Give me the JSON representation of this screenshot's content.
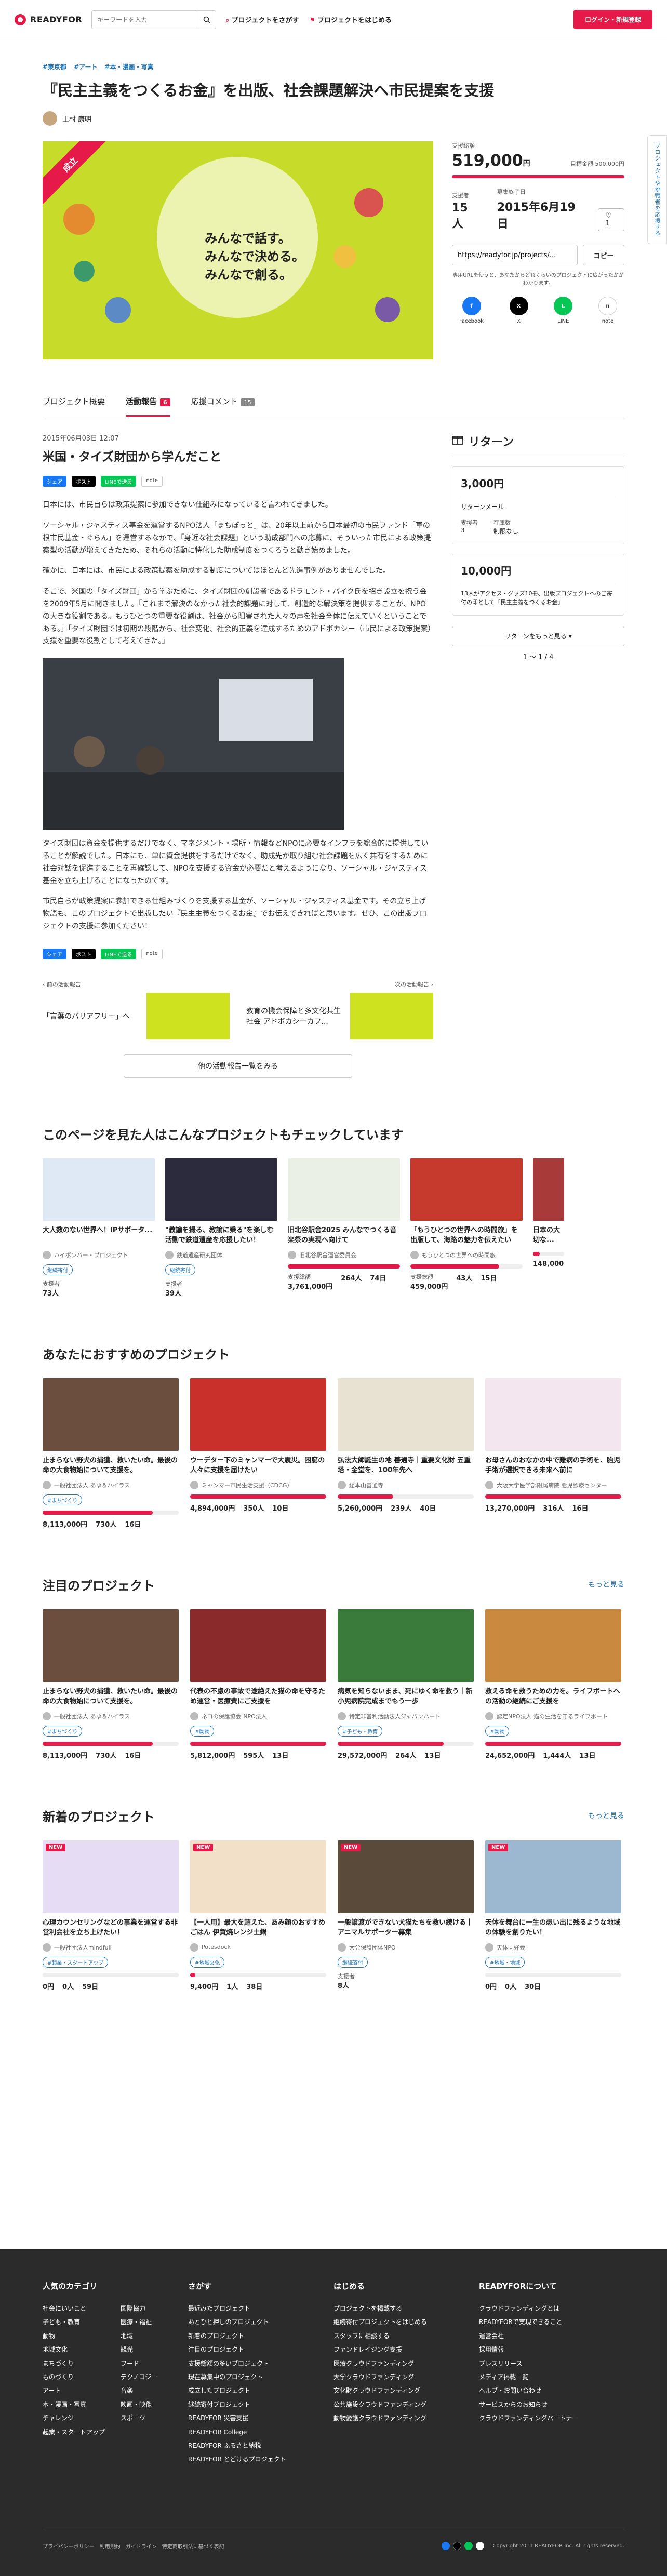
{
  "header": {
    "brand": "READYFOR",
    "search_placeholder": "キーワードを入力",
    "nav": [
      "プロジェクトをさがす",
      "プロジェクトをはじめる"
    ],
    "login": "ログイン・新規登録"
  },
  "side_tab": "プロジェクトや挑戦者を応援する",
  "project": {
    "tags": [
      "#東京都",
      "#アート",
      "#本・漫画・写真"
    ],
    "title": "『民主主義をつくるお金』を出版、社会課題解決へ市民提案を支援",
    "owner": "上村 康明",
    "hero_ribbon": "成立",
    "hero_lines": [
      "みんなで話す。",
      "みんなで決める。",
      "みんなで創る。"
    ],
    "raised_label": "支援総額",
    "raised": "519,000",
    "raised_unit": "円",
    "goal": "目標金額 500,000円",
    "backers_label": "支援者",
    "backers": "15人",
    "end_label": "募集終了日",
    "end_date": "2015年6月19日",
    "bookmark_count": "1",
    "share_url": "https://readyfor.jp/projects/...",
    "copy": "コピー",
    "notice": "専用URLを使うと、あなたからどれくらいのプロジェクトに広がったかがわかります。",
    "sns": [
      "Facebook",
      "X",
      "LINE",
      "note"
    ]
  },
  "tabs": [
    {
      "label": "プロジェクト概要",
      "count": ""
    },
    {
      "label": "活動報告",
      "count": "6"
    },
    {
      "label": "応援コメント",
      "count": "15"
    }
  ],
  "article": {
    "date": "2015年06月03日 12:07",
    "title": "米国・タイズ財団から学んだこと",
    "share": [
      "シェア",
      "ポスト",
      "LINEで送る",
      "note"
    ],
    "p1": "日本には、市民自らは政策提案に参加できない仕組みになっていると言われてきました。",
    "p2": "ソーシャル・ジャスティス基金を運営するNPO法人「まちぽっと」は、20年以上前から日本最初の市民ファンド「草の根市民基金・ぐらん」を運営するなかで、「身近な社会課題」という助成部門への応募に、そういった市民による政策提案型の活動が増えてきたため、それらの活動に特化した助成制度をつくろうと動き始めました。",
    "p3": "確かに、日本には、市民による政策提案を助成する制度についてはほとんど先進事例がありませんでした。",
    "p4": "そこで、米国の「タイズ財団」から学ぶために、タイズ財団の創設者であるドラモント・パイク氏を招き設立を祝う会を2009年5月に開きました。「これまで解決のなかった社会的課題に対して、創造的な解決策を提供することが、NPOの大きな役割である。もうひとつの重要な役割は、社会から阻害された人々の声を社会全体に伝えていくということである。」「タイズ財団では初期の段階から、社会変化、社会的正義を達成するためのアドボカシー（市民による政策提案）支援を重要な役割として考えてきた。」",
    "p5": "タイズ財団は資金を提供するだけでなく、マネジメント・場所・情報などNPOに必要なインフラを総合的に提供していることが解説でした。日本にも、単に資金提供をするだけでなく、助成先が取り組む社会課題を広く共有をするために社会対話を促進することを再確認して、NPOを支援する資金が必要だと考えるようになり、ソーシャル・ジャスティス基金を立ち上げることになったのです。",
    "p6": "市民自らが政策提案に参加できる仕組みづくりを支援する基金が、ソーシャル・ジャスティス基金です。その立ち上げ物語も、このプロジェクトで出版したい『民主主義をつくるお金』でお伝えできればと思います。ぜひ、この出版プロジェクトの支援に参加ください！",
    "prev_label": "前の活動報告",
    "prev_title": "「言葉のバリアフリー」へ",
    "next_label": "次の活動報告",
    "next_title": "教育の機会保障と多文化共生社会 アドボカシーカフ...",
    "all": "他の活動報告一覧をみる"
  },
  "returns": {
    "title": "リターン",
    "cards": [
      {
        "price": "3,000円",
        "name": "リターンメール",
        "l1": "支援者",
        "v1": "3",
        "l2": "在庫数",
        "v2": "制限なし"
      },
      {
        "price": "10,000円",
        "name": "13人がアクセス・グッズ10冊、出版プロジェクトへのご寄付の印として「民主主義をつくるお金」"
      }
    ],
    "more": "リターンをもっと見る",
    "pager": "1 〜 1 / 4"
  },
  "sec1": {
    "title": "このページを見た人はこんなプロジェクトもチェックしています",
    "cards": [
      {
        "title": "大人数のない世界へ！IPサポータ...",
        "owner": "ハイボンバー・プロジェクト",
        "tag": "継続寄付",
        "lbl": "支援者",
        "v": "73人",
        "pct": 0
      },
      {
        "title": "\"教諭を撮る、教諭に乗る\"を楽しむ活動で鉄道遺産を応援したい！",
        "owner": "鉄道遺産研究団体",
        "tag": "継続寄付",
        "lbl": "支援者",
        "v": "39人",
        "pct": 0
      },
      {
        "title": "旧北谷駅舎2025 みんなでつくる音楽祭の実現へ向けて",
        "owner": "旧北谷駅舎運営委員会",
        "tag": "",
        "lbl": "支援総額",
        "v": "3,761,000円",
        "v2": "264人",
        "v3": "74日",
        "pct": 120
      },
      {
        "title": "「もうひとつの世界への時間旅」を出版して、海路の魅力を伝えたい",
        "owner": "もうひとつの世界への時間旅",
        "tag": "",
        "lbl": "支援総額",
        "v": "459,000円",
        "v2": "43人",
        "v3": "15日",
        "pct": 79
      },
      {
        "title": "日本の大切な...",
        "owner": "",
        "tag": "",
        "lbl": "支援総額",
        "v": "148,000",
        "pct": 22
      }
    ]
  },
  "sec2": {
    "title": "あなたにおすすめのプロジェクト",
    "cards": [
      {
        "title": "止まらない野犬の捕獲、救いたい命。最後の命の大食物始について支援を。",
        "owner": "一般社団法人 あゆ＆ハイラス",
        "tag": "#まちづくり",
        "v": "8,113,000円",
        "v2": "730人",
        "v3": "16日",
        "pct": 81
      },
      {
        "title": "ウーデター下のミャンマーで大震災。困窮の人々に支援を届けたい",
        "owner": "ミャンマー市民生活支援（CDCG）",
        "tag": "",
        "v": "4,894,000円",
        "v2": "350人",
        "v3": "10日",
        "pct": 162
      },
      {
        "title": "弘法大師誕生の地 善通寺｜重要文化財 五重塔・金堂を、100年先へ",
        "owner": "総本山善通寺",
        "tag": "",
        "v": "5,260,000円",
        "v2": "239人",
        "v3": "40日",
        "pct": 41
      },
      {
        "title": "お母さんのおなかの中で難病の手術を、胎児手術が選択できる未来へ前に",
        "owner": "大阪大学医学部附属病院 胎児診療センター",
        "tag": "",
        "v": "13,270,000円",
        "v2": "316人",
        "v3": "16日",
        "pct": 132
      }
    ]
  },
  "sec3": {
    "title": "注目のプロジェクト",
    "more": "もっと見る",
    "cards": [
      {
        "title": "止まらない野犬の捕獲、救いたい命。最後の命の大食物始について支援を。",
        "owner": "一般社団法人 あゆ＆ハイラス",
        "tag": "#まちづくり",
        "v": "8,113,000円",
        "v2": "730人",
        "v3": "16日",
        "pct": 81
      },
      {
        "title": "代表の不慮の事故で途絶えた猫の命を守るため運営・医療費にご支援を",
        "owner": "ネコの保護協会 NPO法人",
        "tag": "#動物",
        "v": "5,812,000円",
        "v2": "595人",
        "v3": "13日",
        "pct": 191
      },
      {
        "title": "病気を知らないまま、死にゆく命を救う｜新小児病院完成までもう一歩",
        "owner": "特定非営利活動法人ジャパンハート",
        "tag": "#子ども・教育",
        "v": "29,572,000円",
        "v2": "264人",
        "v3": "13日",
        "pct": 78
      },
      {
        "title": "救える命を救うための力を。ライフボートへの活動の継続にご支援を",
        "owner": "認定NPO法人 猫の生活を守るライフボート",
        "tag": "#動物",
        "v": "24,652,000円",
        "v2": "1,444人",
        "v3": "13日",
        "pct": 246
      }
    ]
  },
  "sec4": {
    "title": "新着のプロジェクト",
    "more": "もっと見る",
    "cards": [
      {
        "title": "心理カウンセリングなどの事業を運営する非営利会社を立ち上げたい！",
        "owner": "一般社団法人mindfull",
        "tag": "#起業・スタートアップ",
        "v": "0円",
        "v2": "0人",
        "v3": "59日",
        "pct": 0
      },
      {
        "title": "【一人用】最大を超えた、あみ顔のおすすめごはん 伊賀焼レンジ土鍋",
        "owner": "Potesdock",
        "tag": "#地域文化",
        "v": "9,400円",
        "v2": "1人",
        "v3": "38日",
        "pct": 4
      },
      {
        "title": "一般譲渡ができない犬猫たちを救い続ける｜アニマルサポーター募集",
        "owner": "大分保護団体NPO",
        "tag": "継続寄付",
        "lbl": "支援者",
        "v": "8人",
        "pct": 0
      },
      {
        "title": "天体を舞台に一生の想い出に残るような地域の体験を創りたい！",
        "owner": "天体同好会",
        "tag": "#地域・地域",
        "v": "0円",
        "v2": "0人",
        "v3": "30日",
        "pct": 0
      }
    ]
  },
  "footer": {
    "c1": {
      "title": "人気のカテゴリ",
      "a": [
        "社会にいいこと",
        "子ども・教育",
        "動物",
        "地域文化",
        "まちづくり",
        "ものづくり",
        "アート",
        "本・漫画・写真",
        "チャレンジ",
        "起業・スタートアップ"
      ],
      "b": [
        "国際協力",
        "医療・福祉",
        "地域",
        "観光",
        "フード",
        "テクノロジー",
        "音楽",
        "映画・映像",
        "スポーツ"
      ]
    },
    "c2": {
      "title": "さがす",
      "a": [
        "最近みたプロジェクト",
        "あとひと押しのプロジェクト",
        "新着のプロジェクト",
        "注目のプロジェクト",
        "支援総額の多いプロジェクト",
        "現在募集中のプロジェクト",
        "成立したプロジェクト",
        "継続寄付プロジェクト",
        "READYFOR 災害支援",
        "READYFOR College",
        "READYFOR ふるさと納税",
        "READYFOR とどけるプロジェクト"
      ]
    },
    "c3": {
      "title": "はじめる",
      "a": [
        "プロジェクトを掲載する",
        "継続寄付プロジェクトをはじめる",
        "スタッフに相談する",
        "ファンドレイジング支援",
        "医療クラウドファンディング",
        "大学クラウドファンディング",
        "文化財クラウドファンディング",
        "公共施設クラウドファンディング",
        "動物愛護クラウドファンディング"
      ]
    },
    "c4": {
      "title": "READYFORについて",
      "a": [
        "クラウドファンディングとは",
        "READYFORで実現できること",
        "運営会社",
        "採用情報",
        "プレスリリース",
        "メディア掲載一覧",
        "ヘルプ・お問い合わせ",
        "サービスからのお知らせ",
        "クラウドファンディングパートナー"
      ]
    },
    "links": "プライバシーポリシー　利用規約　ガイドライン　特定商取引法に基づく表記",
    "copyright": "Copyright 2011 READYFOR Inc. All rights reserved."
  },
  "colors": {
    "accent": "#e51a48",
    "link": "#1e74b8",
    "hero": "#c7dc2a"
  }
}
